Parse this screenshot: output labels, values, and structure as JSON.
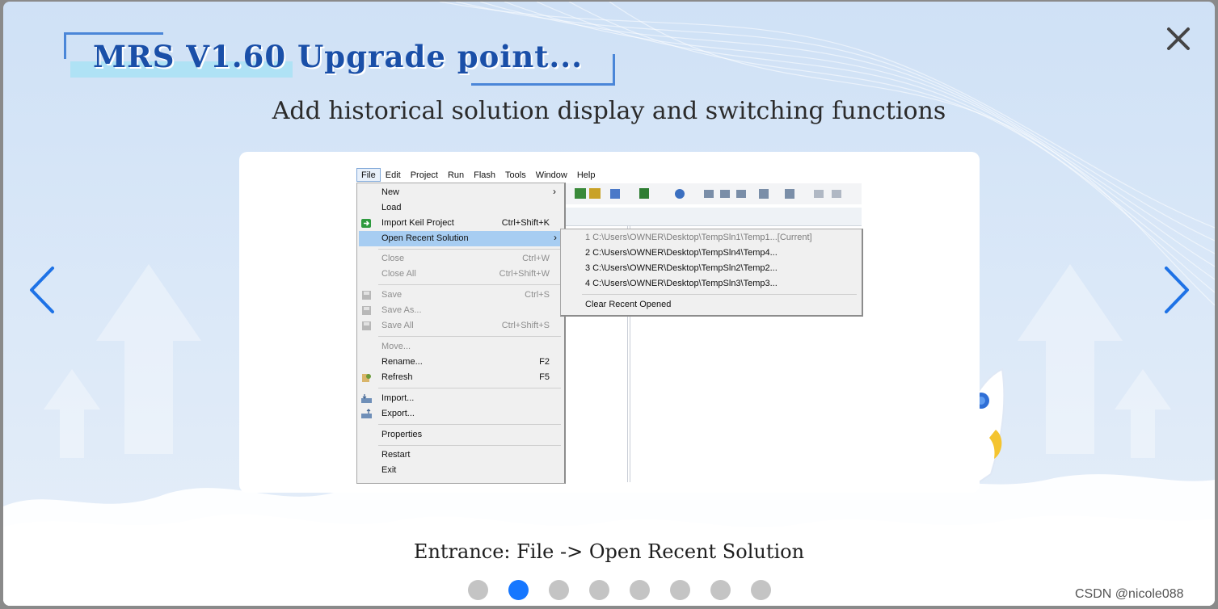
{
  "dialog": {
    "title": "MRS V1.60 Upgrade point...",
    "subtitle": "Add historical solution display and switching functions",
    "caption": "Entrance: File -> Open Recent Solution",
    "close_icon": "close-icon",
    "prev_icon": "chevron-left-icon",
    "next_icon": "chevron-right-icon",
    "accent_color": "#1677ff",
    "title_color": "#1a4fa8"
  },
  "pagination": {
    "count": 8,
    "active_index": 1
  },
  "screenshot": {
    "menubar": [
      "File",
      "Edit",
      "Project",
      "Run",
      "Flash",
      "Tools",
      "Window",
      "Help"
    ],
    "file_menu": [
      {
        "label": "New",
        "shortcut": "",
        "submenu": true
      },
      {
        "label": "Load",
        "shortcut": ""
      },
      {
        "label": "Import Keil Project",
        "shortcut": "Ctrl+Shift+K",
        "icon": "import-keil-icon"
      },
      {
        "label": "Open Recent Solution",
        "shortcut": "",
        "submenu": true,
        "selected": true
      },
      {
        "label": "Close",
        "shortcut": "Ctrl+W",
        "disabled": true
      },
      {
        "label": "Close All",
        "shortcut": "Ctrl+Shift+W",
        "disabled": true
      },
      {
        "label": "Save",
        "shortcut": "Ctrl+S",
        "disabled": true,
        "icon": "save-icon"
      },
      {
        "label": "Save As...",
        "shortcut": "",
        "disabled": true,
        "icon": "save-as-icon"
      },
      {
        "label": "Save All",
        "shortcut": "Ctrl+Shift+S",
        "disabled": true,
        "icon": "save-all-icon"
      },
      {
        "label": "Move...",
        "shortcut": "",
        "disabled": true
      },
      {
        "label": "Rename...",
        "shortcut": "F2"
      },
      {
        "label": "Refresh",
        "shortcut": "F5",
        "icon": "refresh-icon"
      },
      {
        "label": "Import...",
        "shortcut": "",
        "icon": "import-icon"
      },
      {
        "label": "Export...",
        "shortcut": "",
        "icon": "export-icon"
      },
      {
        "label": "Properties",
        "shortcut": ""
      },
      {
        "label": "Restart",
        "shortcut": ""
      },
      {
        "label": "Exit",
        "shortcut": ""
      }
    ],
    "recent_solutions": [
      {
        "label": "1 C:\\Users\\OWNER\\Desktop\\TempSln1\\Temp1...[Current]",
        "disabled": true
      },
      {
        "label": "2 C:\\Users\\OWNER\\Desktop\\TempSln4\\Temp4..."
      },
      {
        "label": "3 C:\\Users\\OWNER\\Desktop\\TempSln2\\Temp2..."
      },
      {
        "label": "4 C:\\Users\\OWNER\\Desktop\\TempSln3\\Temp3..."
      },
      {
        "label": "Clear Recent Opened"
      }
    ]
  },
  "watermark": "CSDN @nicole088"
}
